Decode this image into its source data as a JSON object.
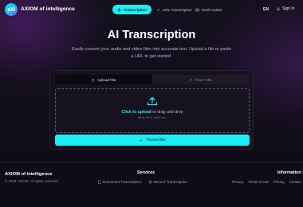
{
  "brand": {
    "logo_text": "aXi",
    "name": "AXIOM of intelligence"
  },
  "nav": {
    "tabs": [
      {
        "label": "Transcription",
        "icon": "waveform-icon",
        "active": true
      },
      {
        "label": "URL Transcription",
        "icon": "link-icon",
        "active": false
      },
      {
        "label": "Reels maker",
        "icon": "film-icon",
        "active": false
      }
    ],
    "language": "EN",
    "sign_in": "Sign In"
  },
  "hero": {
    "title": "AI Transcription",
    "subtitle": "Easily convert your audio and video files into accurate text. Upload a file or paste a URL to get started."
  },
  "uploader": {
    "tabs": [
      {
        "label": "Upload File",
        "icon": "upload-icon",
        "active": true
      },
      {
        "label": "From URL",
        "icon": "link-icon",
        "active": false
      }
    ],
    "dropzone": {
      "link_text": "Click to upload",
      "rest_text": " or drag and drop",
      "formats": "MP3, MP4, WAV, etc."
    },
    "button_label": "Transcribe"
  },
  "footer": {
    "brand": "AXIOM of intelligence",
    "copyright": "© 2025 AXIOM. All rights reserved.",
    "services_heading": "Services",
    "services": [
      "Document Transcription",
      "Record Transcription"
    ],
    "info_heading": "Information",
    "info_links": [
      "Privacy",
      "Terms of Use",
      "Pricing",
      "Contact"
    ]
  },
  "colors": {
    "accent": "#19eef2",
    "background": "#0c0a14",
    "card": "#16131f"
  }
}
